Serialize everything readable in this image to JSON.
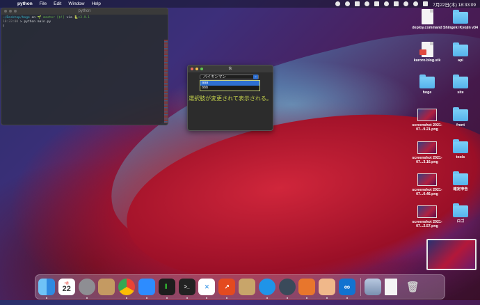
{
  "menubar": {
    "app_name": "python",
    "items": [
      "File",
      "Edit",
      "Window",
      "Help"
    ],
    "datetime": "7月22日(木) 18:33:09"
  },
  "terminal": {
    "title": "python",
    "line1_path": "~/Desktop/hoge",
    "line1_on": " on ",
    "line1_branch": "🌱 master [$!]",
    "line1_via": " via ",
    "line1_version": "🐍v3.9.1",
    "line2_time": "18:33:00",
    "line2_cmd": " > python main.py"
  },
  "tk_window": {
    "title": "tk",
    "combo_value": "バイキンマン",
    "options": [
      "aaa",
      "bbb"
    ],
    "selected_index": 0,
    "label": "選択肢が変更されて表示される。"
  },
  "desktop_icons": [
    {
      "label": "deploy.command",
      "type": "doc"
    },
    {
      "label": "Shingeki Kyojin v34",
      "type": "folder"
    },
    {
      "label": "kuroro.blog.stk",
      "type": "doc"
    },
    {
      "label": "api",
      "type": "folder"
    },
    {
      "label": "hoge",
      "type": "folder"
    },
    {
      "label": "site",
      "type": "folder"
    },
    {
      "label": "screenshot 2021-07...9.21.png",
      "type": "thumb"
    },
    {
      "label": "front",
      "type": "folder"
    },
    {
      "label": "screenshot 2021-07...3.16.png",
      "type": "thumb"
    },
    {
      "label": "tools",
      "type": "folder"
    },
    {
      "label": "screenshot 2021-07...0.46.png",
      "type": "thumb"
    },
    {
      "label": "確定申告",
      "type": "folder"
    },
    {
      "label": "screenshot 2021-07...2.57.png",
      "type": "thumb"
    },
    {
      "label": "ロゴ",
      "type": "folder"
    }
  ],
  "dock": {
    "calendar_month": "7月",
    "calendar_day": "22",
    "apps": [
      "finder-icon",
      "calendar-icon",
      "system-preferences-icon",
      "contacts-icon",
      "chrome-icon",
      "zoom-icon",
      "terminal-icon",
      "terminal-icon",
      "vscode-icon",
      "stats-icon",
      "archive-icon",
      "docker-icon",
      "quicktime-icon",
      "sourcetree-icon",
      "notes-icon",
      "infinity-icon"
    ]
  },
  "colors": {
    "tk_label": "#c6d34b",
    "selection": "#2e6fd1",
    "folder": "#5ab8ef"
  }
}
